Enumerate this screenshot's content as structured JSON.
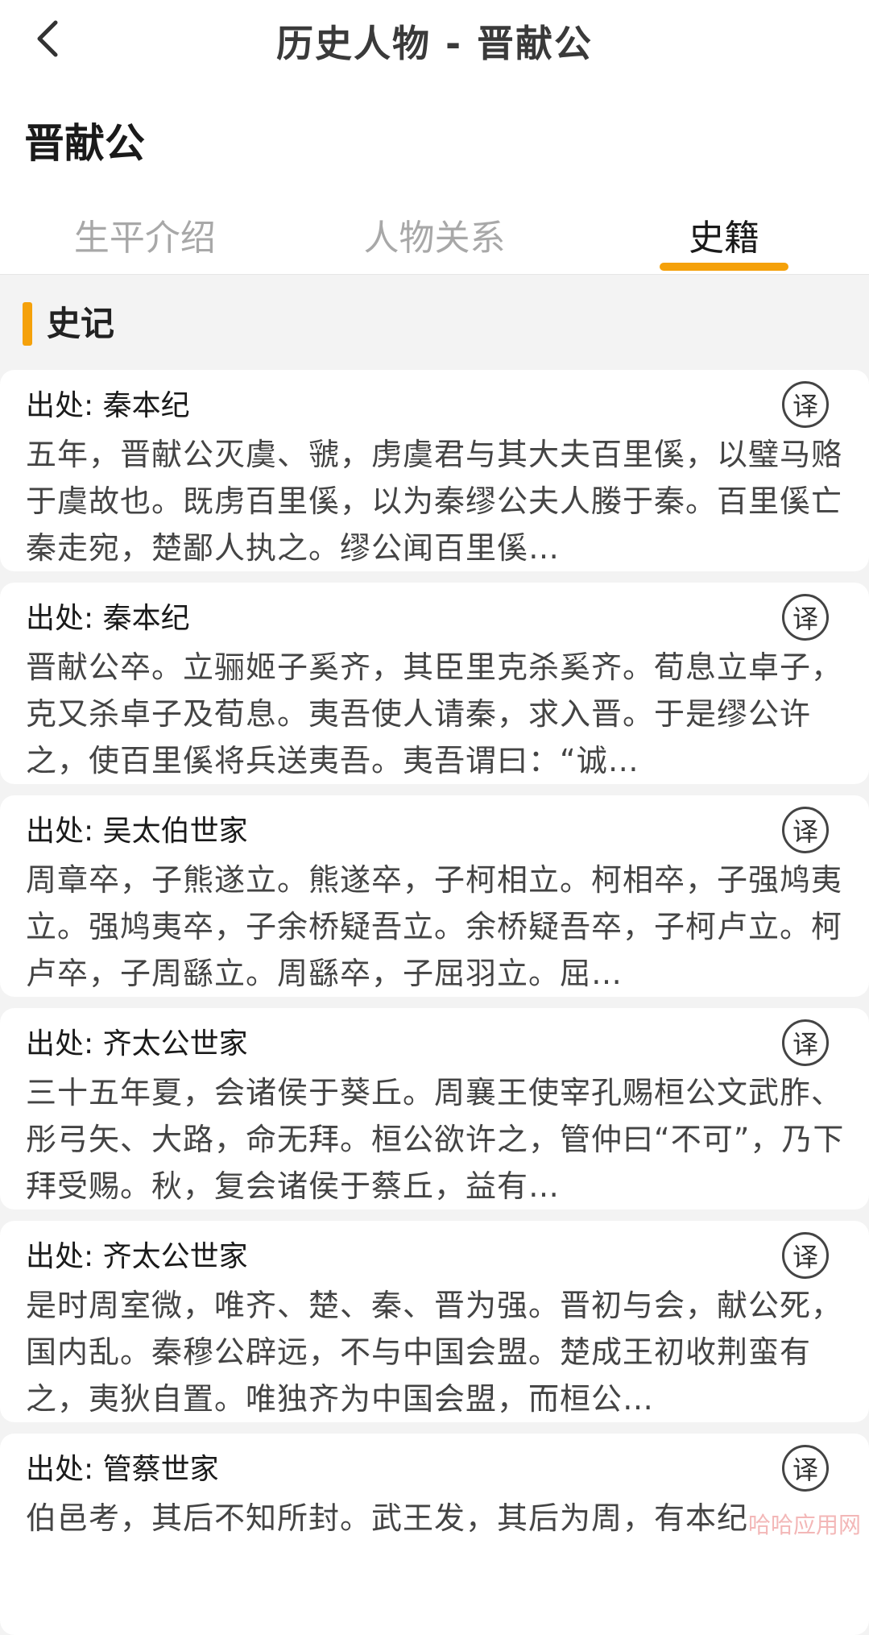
{
  "header": {
    "title": "历史人物 - 晋献公"
  },
  "person": {
    "name": "晋献公"
  },
  "tabs": [
    {
      "label": "生平介绍",
      "active": false
    },
    {
      "label": "人物关系",
      "active": false
    },
    {
      "label": "史籍",
      "active": true
    }
  ],
  "section": {
    "title": "史记"
  },
  "cards": [
    {
      "source": "出处: 秦本纪",
      "translate_label": "译",
      "text": "五年，晋献公灭虞、虢，虏虞君与其大夫百里傒，以璧马赂于虞故也。既虏百里傒，以为秦缪公夫人媵于秦。百里傒亡秦走宛，楚鄙人执之。缪公闻百里傒…"
    },
    {
      "source": "出处: 秦本纪",
      "translate_label": "译",
      "text": "晋献公卒。立骊姬子奚齐，其臣里克杀奚齐。荀息立卓子，克又杀卓子及荀息。夷吾使人请秦，求入晋。于是缪公许之，使百里傒将兵送夷吾。夷吾谓曰：“诚…"
    },
    {
      "source": "出处: 吴太伯世家",
      "translate_label": "译",
      "text": "周章卒，子熊遂立。熊遂卒，子柯相立。柯相卒，子强鸠夷立。强鸠夷卒，子余桥疑吾立。余桥疑吾卒，子柯卢立。柯卢卒，子周繇立。周繇卒，子屈羽立。屈…"
    },
    {
      "source": "出处: 齐太公世家",
      "translate_label": "译",
      "text": "三十五年夏，会诸侯于葵丘。周襄王使宰孔赐桓公文武胙、彤弓矢、大路，命无拜。桓公欲许之，管仲曰“不可”，乃下拜受赐。秋，复会诸侯于蔡丘，益有…"
    },
    {
      "source": "出处: 齐太公世家",
      "translate_label": "译",
      "text": "是时周室微，唯齐、楚、秦、晋为强。晋初与会，献公死，国内乱。秦穆公辟远，不与中国会盟。楚成王初收荆蛮有之，夷狄自置。唯独齐为中国会盟，而桓公…"
    },
    {
      "source": "出处: 管蔡世家",
      "translate_label": "译",
      "text": "伯邑考，其后不知所封。武王发，其后为周，有本纪"
    }
  ],
  "watermark": {
    "text": "哈哈应用网"
  }
}
